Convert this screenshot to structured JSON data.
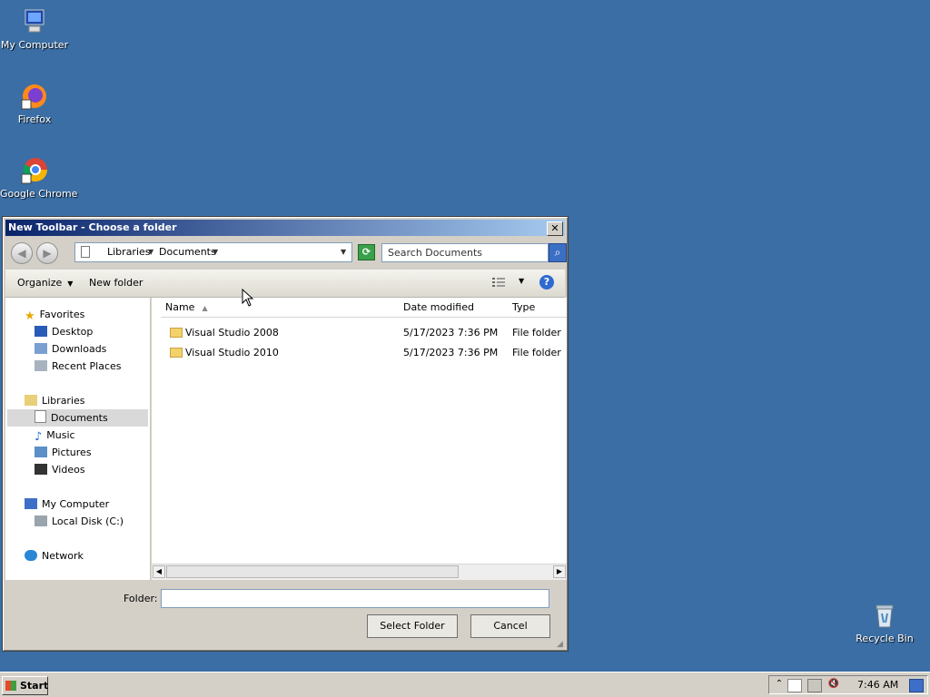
{
  "desktop": {
    "icons": [
      {
        "label": "My Computer"
      },
      {
        "label": "Firefox"
      },
      {
        "label": "Google Chrome"
      },
      {
        "label": "Recycle Bin"
      }
    ]
  },
  "dialog": {
    "title": "New Toolbar - Choose a folder",
    "close_label": "✕",
    "breadcrumb": [
      "Libraries",
      "Documents"
    ],
    "search_placeholder": "Search Documents",
    "toolbar": {
      "organize": "Organize",
      "new_folder": "New folder",
      "help": "?"
    },
    "nav": {
      "favorites": "Favorites",
      "desktop": "Desktop",
      "downloads": "Downloads",
      "recent_places": "Recent Places",
      "libraries": "Libraries",
      "documents": "Documents",
      "music": "Music",
      "pictures": "Pictures",
      "videos": "Videos",
      "my_computer": "My Computer",
      "local_disk": "Local Disk (C:)",
      "network": "Network"
    },
    "columns": {
      "name": "Name",
      "date_modified": "Date modified",
      "type": "Type"
    },
    "rows": [
      {
        "name": "Visual Studio 2008",
        "date": "5/17/2023 7:36 PM",
        "type": "File folder"
      },
      {
        "name": "Visual Studio 2010",
        "date": "5/17/2023 7:36 PM",
        "type": "File folder"
      }
    ],
    "folder_label": "Folder:",
    "folder_value": "",
    "select_button": "Select Folder",
    "cancel_button": "Cancel"
  },
  "taskbar": {
    "start": "Start",
    "clock": "7:46 AM"
  },
  "colors": {
    "desktop": "#3a6ea5",
    "title_start": "#0a246a",
    "title_end": "#a6caf0"
  }
}
